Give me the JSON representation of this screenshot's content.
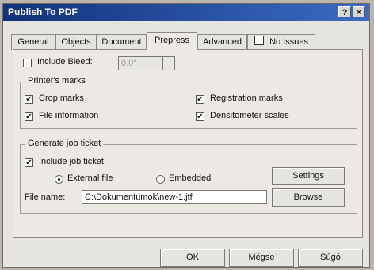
{
  "window": {
    "title": "Publish To PDF",
    "help_label": "?",
    "close_label": "×"
  },
  "tabs": [
    "General",
    "Objects",
    "Document",
    "Prepress",
    "Advanced",
    "No Issues"
  ],
  "bleed": {
    "label": "Include Bleed:",
    "value": "0.0\""
  },
  "printers_marks": {
    "title": "Printer's marks",
    "crop": "Crop marks",
    "registration": "Registration marks",
    "file_info": "File information",
    "densitometer": "Densitometer scales"
  },
  "job_ticket": {
    "title": "Generate job ticket",
    "include": "Include job ticket",
    "external": "External file",
    "embedded": "Embedded",
    "settings": "Settings",
    "filename_label": "File name:",
    "filename_value": "C:\\Dokumentumok\\new-1.jtf",
    "browse": "Browse"
  },
  "footer": {
    "ok": "OK",
    "cancel": "Mégse",
    "help": "Súgó"
  }
}
